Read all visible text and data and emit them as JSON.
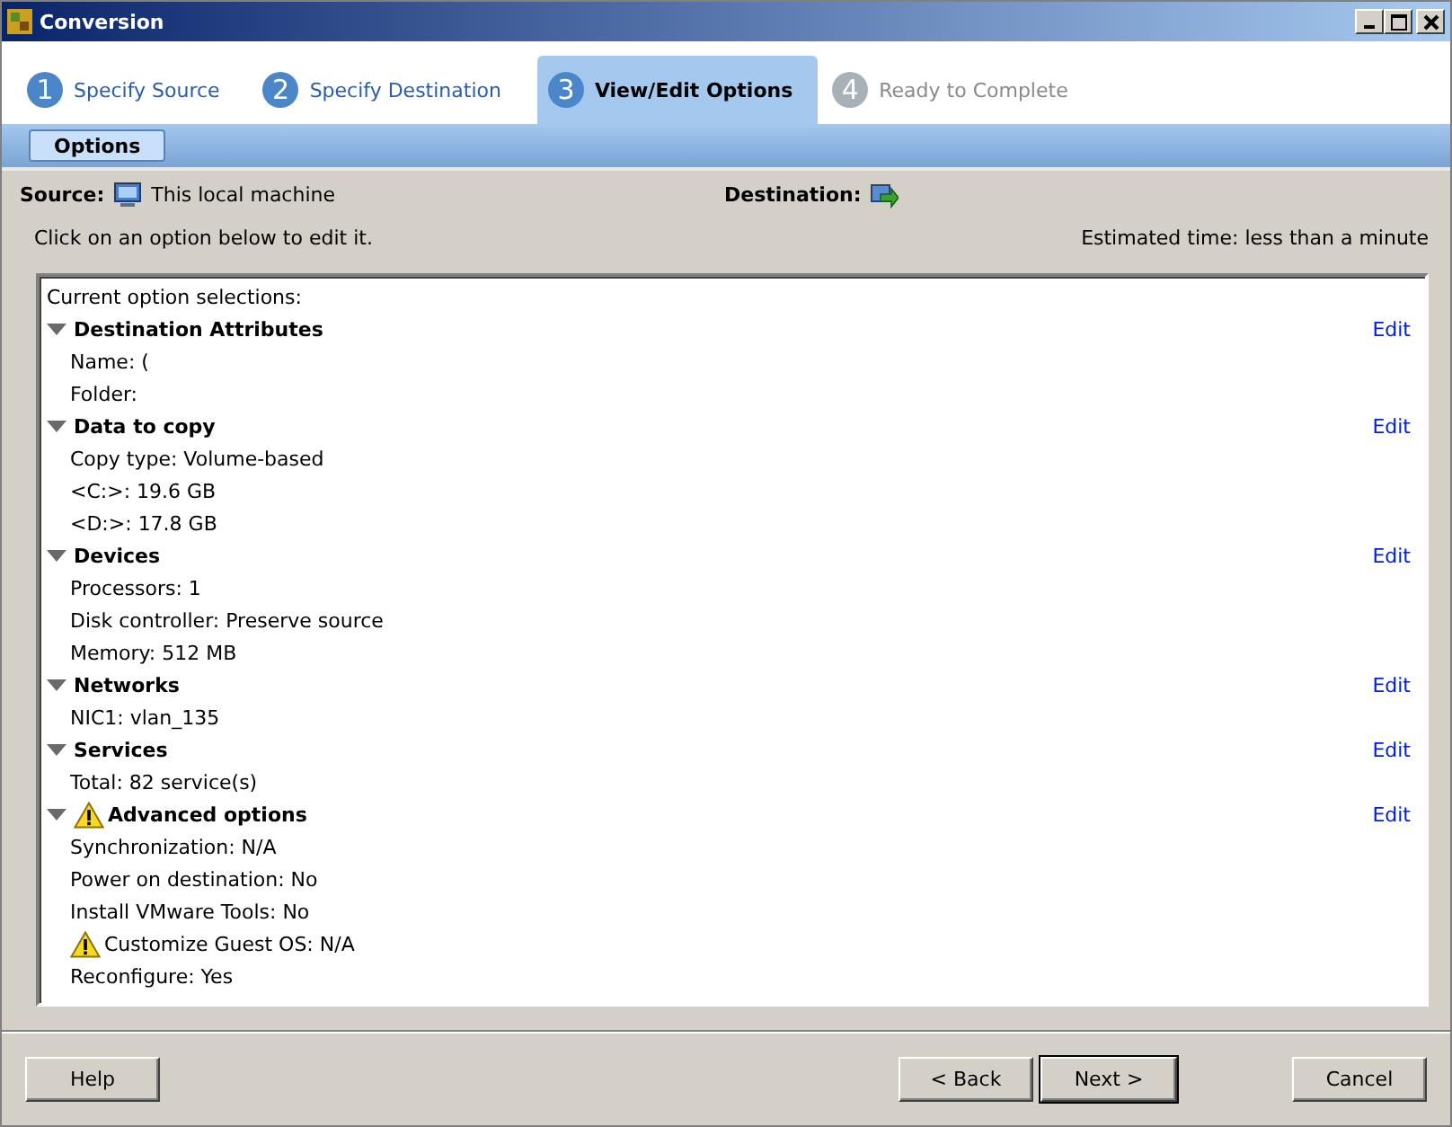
{
  "window": {
    "title": "Conversion"
  },
  "steps": [
    {
      "number": "1",
      "label": "Specify Source",
      "selected": false,
      "disabled": false
    },
    {
      "number": "2",
      "label": "Specify Destination",
      "selected": false,
      "disabled": false
    },
    {
      "number": "3",
      "label": "View/Edit Options",
      "selected": true,
      "disabled": false
    },
    {
      "number": "4",
      "label": "Ready to Complete",
      "selected": false,
      "disabled": true
    }
  ],
  "subtabs": [
    {
      "label": "Options",
      "selected": true
    }
  ],
  "source": {
    "label": "Source:",
    "value": "This local machine"
  },
  "destination": {
    "label": "Destination:"
  },
  "hint": "Click on an option below to edit it.",
  "estimate": {
    "label": "Estimated time:",
    "value": "less than a minute"
  },
  "options": {
    "heading": "Current option selections:",
    "sections": [
      {
        "title": "Destination Attributes",
        "expanded": true,
        "edit": "Edit",
        "items": [
          {
            "text": "Name: ("
          },
          {
            "text": "Folder:"
          }
        ]
      },
      {
        "title": "Data to copy",
        "expanded": true,
        "edit": "Edit",
        "items": [
          {
            "text": "Copy type: Volume-based"
          },
          {
            "text": "<C:>: 19.6 GB"
          },
          {
            "text": "<D:>: 17.8 GB"
          }
        ]
      },
      {
        "title": "Devices",
        "expanded": true,
        "edit": "Edit",
        "items": [
          {
            "text": "Processors: 1"
          },
          {
            "text": "Disk controller: Preserve source"
          },
          {
            "text": "Memory: 512 MB"
          }
        ]
      },
      {
        "title": "Networks",
        "expanded": true,
        "edit": "Edit",
        "items": [
          {
            "text": "NIC1: vlan_135"
          }
        ]
      },
      {
        "title": "Services",
        "expanded": true,
        "edit": "Edit",
        "items": [
          {
            "text": "Total: 82 service(s)"
          }
        ]
      },
      {
        "title": "Advanced options",
        "expanded": true,
        "warning": true,
        "edit": "Edit",
        "items": [
          {
            "text": "Synchronization: N/A"
          },
          {
            "text": "Power on destination: No"
          },
          {
            "text": "Install VMware Tools: No"
          },
          {
            "text": "Customize Guest OS: N/A",
            "warning": true
          },
          {
            "text": "Reconfigure: Yes"
          }
        ]
      }
    ]
  },
  "buttons": {
    "left": [
      {
        "label": "Help",
        "default": false
      }
    ],
    "right": [
      {
        "label": "< Back",
        "default": false
      },
      {
        "label": "Next >",
        "default": true
      },
      {
        "label": "Cancel",
        "default": false
      }
    ]
  }
}
